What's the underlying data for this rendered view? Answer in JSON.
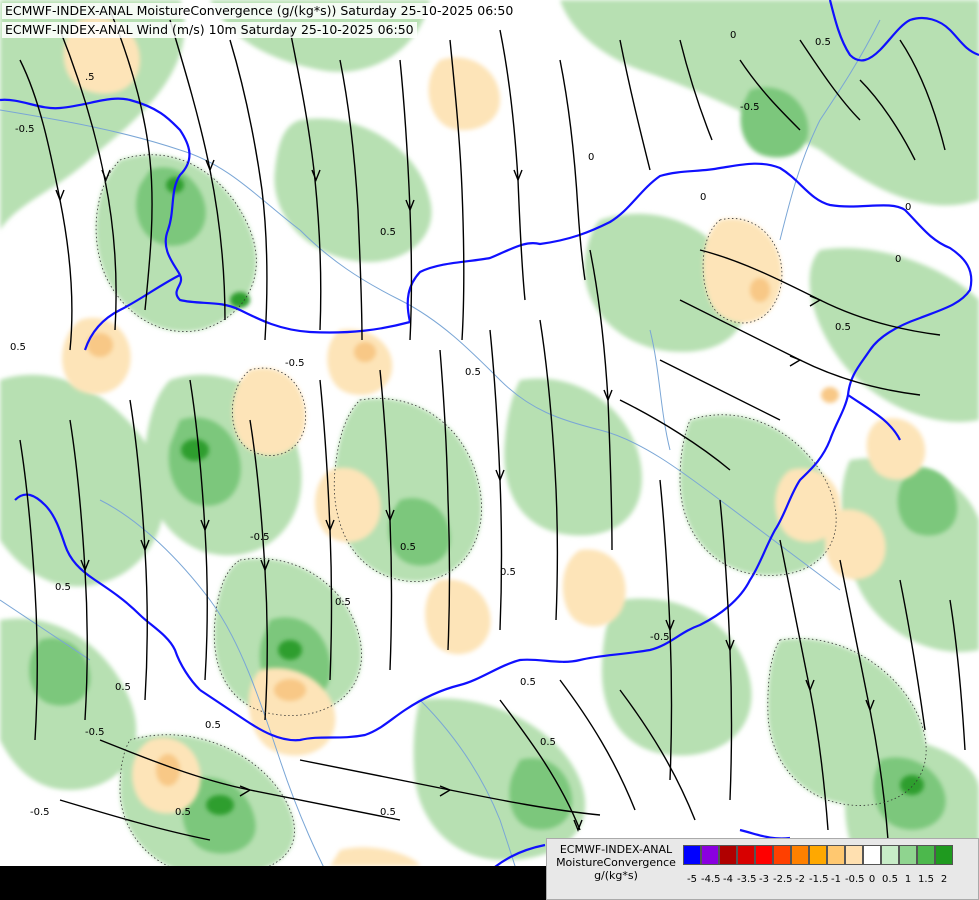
{
  "titles": {
    "line1": "ECMWF-INDEX-ANAL MoistureConvergence (g/(kg*s)) Saturday 25-10-2025 06:50",
    "line2": "ECMWF-INDEX-ANAL Wind (m/s) 10m Saturday 25-10-2025 06:50"
  },
  "legend": {
    "model": "ECMWF-INDEX-ANAL",
    "variable": "MoistureConvergence",
    "unit": "g/(kg*s)",
    "ticks": [
      "-5",
      "-4.5",
      "-4",
      "-3.5",
      "-3",
      "-2.5",
      "-2",
      "-1.5",
      "-1",
      "-0.5",
      "0",
      "0.5",
      "1",
      "1.5",
      "2"
    ],
    "colors": [
      "#0000ff",
      "#8a00e0",
      "#b00000",
      "#d80000",
      "#ff0000",
      "#ff4000",
      "#ff8000",
      "#ffa800",
      "#ffc870",
      "#ffe0b0",
      "#ffffff",
      "#c8ecc8",
      "#8fd48f",
      "#4cb84c",
      "#1f9a1f"
    ]
  },
  "map": {
    "contour_labels": [
      "0",
      "0.5",
      "-0.5",
      ".5",
      "0",
      "-0.5",
      "0.5",
      "0.5",
      "-0.5",
      "0.5",
      "0",
      "0.5",
      "0.5",
      "-0.5",
      "0.5",
      "0",
      "0.5",
      "-0.5",
      "0.5",
      "0.5",
      "-0.5",
      "0.5",
      "0.5",
      "0",
      "-0.5",
      "0.5",
      "0.5",
      "0.5"
    ],
    "colors": {
      "background": "#ffffff",
      "convergence_light": "#b7e0b2",
      "convergence_mid": "#7cc77c",
      "convergence_strong": "#2e9e2e",
      "divergence_light": "#fde4b8",
      "divergence_mid": "#f8c886",
      "border": "#1010ff",
      "river": "#7aa6d6",
      "streamline": "#000000"
    }
  }
}
